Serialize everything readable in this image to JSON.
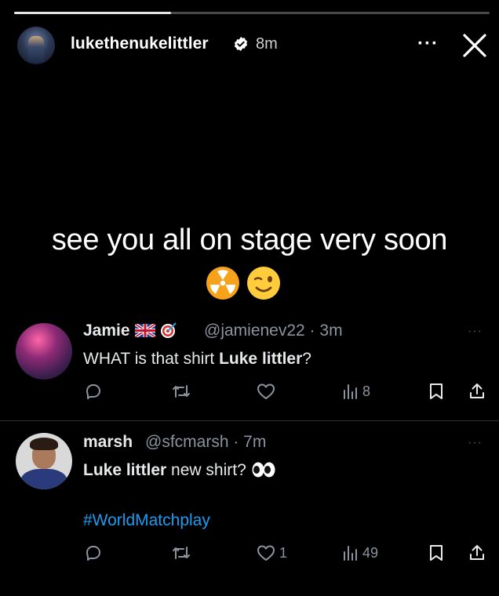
{
  "story": {
    "progress_fraction": 0.33,
    "username": "lukethenukelittler",
    "time": "8m",
    "more_label": "···",
    "caption": "see you all on stage very soon"
  },
  "tweets": [
    {
      "name": "Jamie",
      "handle": "@jamienev22",
      "time": "3m",
      "text_before": "WHAT is that shirt ",
      "text_bold": "Luke littler",
      "text_after": "?",
      "replies": "",
      "retweets": "",
      "likes": "",
      "views": "8",
      "more_label": "···"
    },
    {
      "name": "marsh",
      "handle": "@sfcmarsh",
      "time": "7m",
      "text_bold": "Luke littler",
      "text_after": " new shirt?",
      "hashtag": "#WorldMatchplay",
      "replies": "",
      "retweets": "",
      "likes": "1",
      "views": "49",
      "more_label": "···"
    }
  ],
  "icons": {
    "verified": "verified-badge-icon",
    "close": "close-icon",
    "reply": "reply-icon",
    "retweet": "retweet-icon",
    "like": "like-icon",
    "views": "views-icon",
    "bookmark": "bookmark-icon",
    "share": "share-icon"
  },
  "colors": {
    "background": "#000000",
    "link": "#1d9bf0",
    "muted": "#8b949e"
  }
}
